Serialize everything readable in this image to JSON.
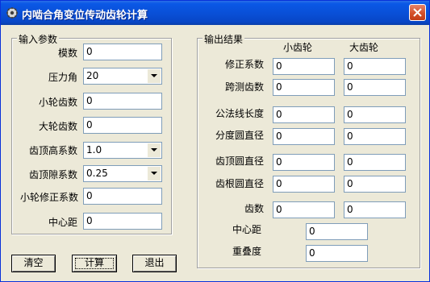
{
  "window": {
    "title": "内啮合角变位传动齿轮计算",
    "close_symbol": "✕"
  },
  "input_group": {
    "legend": "输入参数",
    "fields": [
      {
        "label": "模数",
        "value": "0"
      },
      {
        "label": "压力角",
        "value": "20"
      },
      {
        "label": "小轮齿数",
        "value": "0"
      },
      {
        "label": "大轮齿数",
        "value": "0"
      },
      {
        "label": "齿顶高系数",
        "value": "1.0"
      },
      {
        "label": "齿顶隙系数",
        "value": "0.25"
      },
      {
        "label": "小轮修正系数",
        "value": "0"
      },
      {
        "label": "中心距",
        "value": "0"
      }
    ]
  },
  "output_group": {
    "legend": "输出结果",
    "col_small": "小齿轮",
    "col_large": "大齿轮",
    "rows": [
      {
        "label": "修正系数",
        "small": "0",
        "large": "0"
      },
      {
        "label": "跨测齿数",
        "small": "0",
        "large": "0"
      },
      {
        "label": "公法线长度",
        "small": "0",
        "large": "0"
      },
      {
        "label": "分度圆直径",
        "small": "0",
        "large": "0"
      },
      {
        "label": "齿顶圆直径",
        "small": "0",
        "large": "0"
      },
      {
        "label": "齿根圆直径",
        "small": "0",
        "large": "0"
      },
      {
        "label": "齿数",
        "small": "0",
        "large": "0"
      }
    ],
    "center_distance_label": "中心距",
    "center_distance_value": "0",
    "overlap_label": "重叠度",
    "overlap_value": "0"
  },
  "buttons": {
    "clear": "清空",
    "calc": "计算",
    "exit": "退出"
  }
}
